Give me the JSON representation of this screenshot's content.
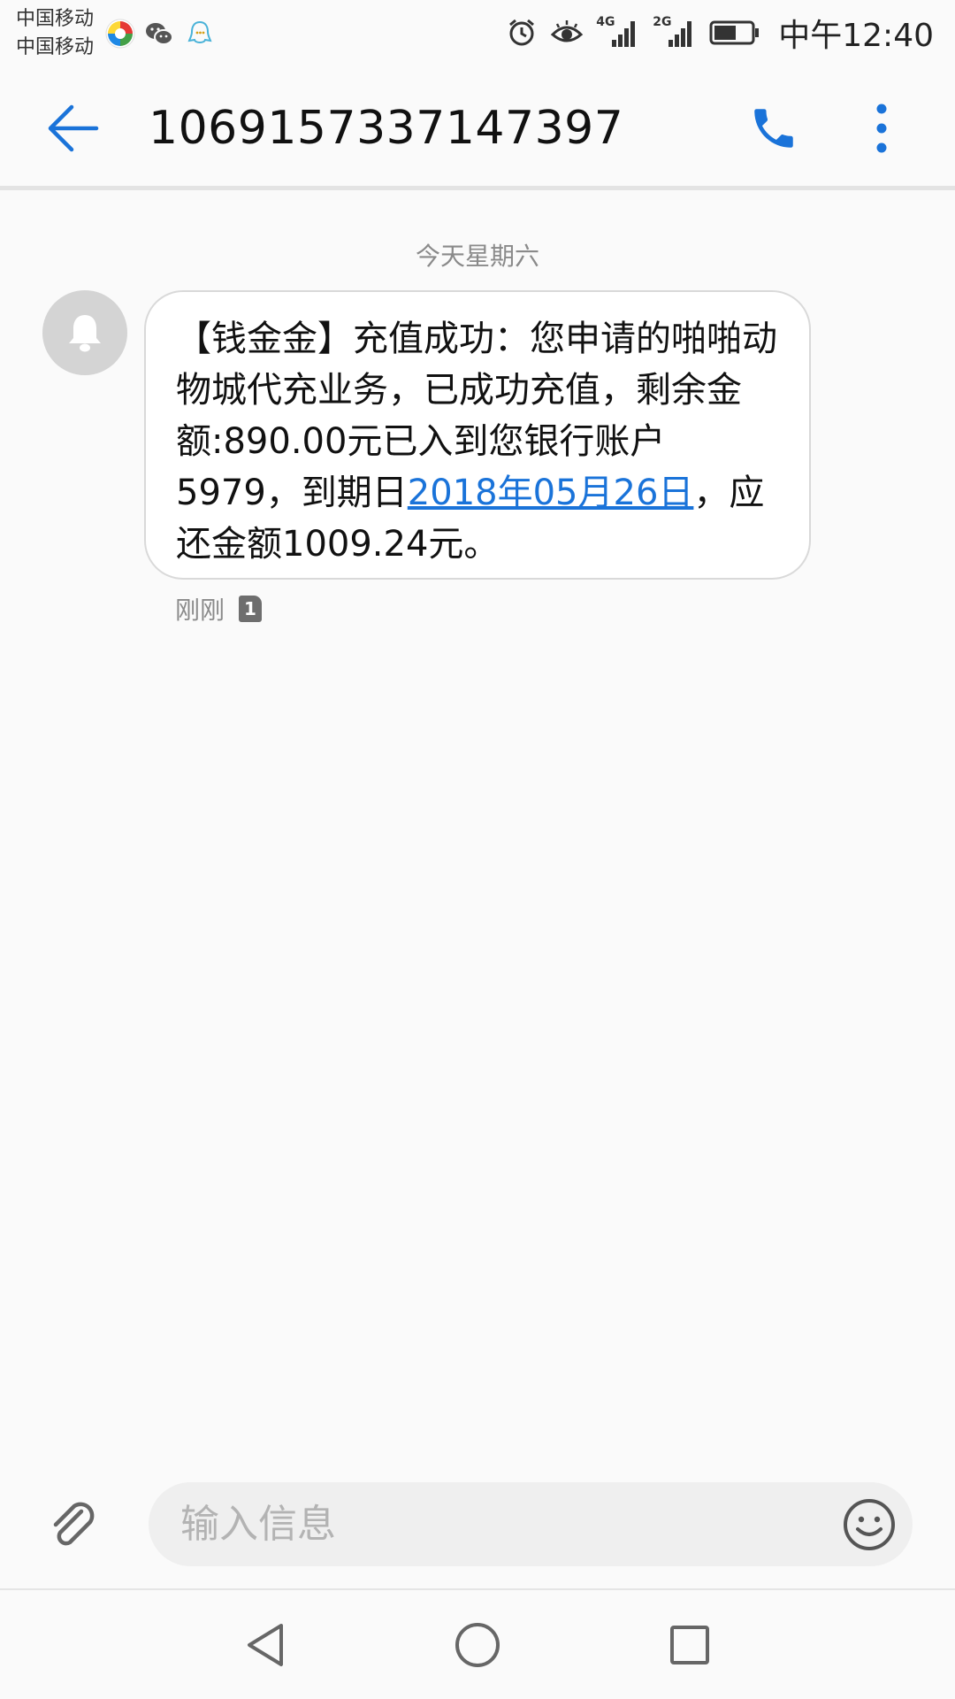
{
  "status_bar": {
    "carrier_1": "中国移动",
    "carrier_2": "中国移动",
    "network_1": "4G",
    "network_2": "2G",
    "time": "中午12:40",
    "icons": [
      "colorful-app-icon",
      "wechat-icon",
      "qq-icon",
      "alarm-icon",
      "eye-comfort-icon",
      "signal-icon",
      "battery-icon"
    ]
  },
  "header": {
    "title": "10691573371473 97",
    "back_icon": "arrow-left-icon",
    "call_icon": "phone-icon",
    "more_icon": "more-vertical-icon"
  },
  "conversation": {
    "date_separator": "今天星期六",
    "messages": [
      {
        "text_before": "【钱金金】充值成功：您申请的啪啪动物城代充业务，已成功充值，剩余金额:890.00元已入到您银行账户5979，到期日",
        "link_text": "2018年05月26日",
        "text_after": "，应还金额1009.24元。",
        "time": "刚刚",
        "sim_slot": "1"
      }
    ]
  },
  "composer": {
    "placeholder": "输入信息",
    "attach_icon": "paperclip-icon",
    "emoji_icon": "smiley-icon"
  },
  "nav": {
    "icons": [
      "back-triangle-icon",
      "home-circle-icon",
      "recents-square-icon"
    ]
  },
  "colors": {
    "accent": "#1a73d9",
    "background": "#fafafa",
    "bubble": "#ffffff",
    "avatar": "#d4d4d4"
  }
}
